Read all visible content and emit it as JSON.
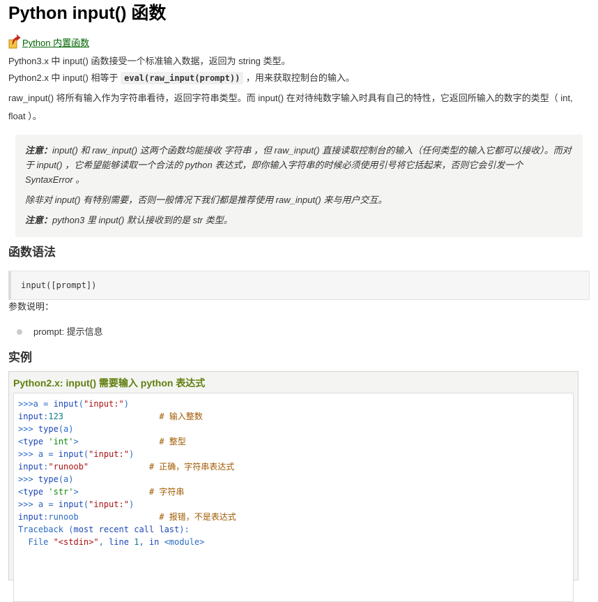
{
  "title": "Python input() 函数",
  "back_link": "Python 内置函数",
  "intro": {
    "p1": "Python3.x 中 input() 函数接受一个标准输入数据，返回为 string 类型。",
    "p2_before": "Python2.x 中 input() 相等于",
    "p2_code": "eval(raw_input(prompt))",
    "p2_after": "，用来获取控制台的输入。",
    "p3": "raw_input() 将所有输入作为字符串看待，返回字符串类型。而 input() 在对待纯数字输入时具有自己的特性，它返回所输入的数字的类型（ int, float ）。"
  },
  "note": {
    "label1": "注意：",
    "text1": "input() 和 raw_input() 这两个函数均能接收 字符串 ，但 raw_input() 直接读取控制台的输入（任何类型的输入它都可以接收）。而对于 input() ，它希望能够读取一个合法的 python 表达式，即你输入字符串的时候必须使用引号将它括起来，否则它会引发一个 SyntaxError 。",
    "text2": "除非对 input() 有特别需要，否则一般情况下我们都是推荐使用 raw_input() 来与用户交互。",
    "label3": "注意：",
    "text3": "python3 里 input() 默认接收到的是 str 类型。"
  },
  "syntax_heading": "函数语法",
  "syntax_code": "input([prompt])",
  "params_label": "参数说明：",
  "params": [
    "prompt: 提示信息"
  ],
  "example_heading": "实例",
  "example_title": "Python2.x: input() 需要输入 python 表达式",
  "code_lines": [
    {
      "a": ">>>a = input(\"input:\")",
      "b": ""
    },
    {
      "a": "input:123",
      "b": "# 输入整数"
    },
    {
      "a": ">>> type(a)",
      "b": ""
    },
    {
      "a": "<type 'int'>",
      "b": "# 整型"
    },
    {
      "a": ">>> a = input(\"input:\")",
      "b": ""
    },
    {
      "a": "input:\"runoob\"",
      "b": "# 正确，字符串表达式"
    },
    {
      "a": ">>> type(a)",
      "b": ""
    },
    {
      "a": "<type 'str'>",
      "b": "# 字符串"
    },
    {
      "a": ">>> a = input(\"input:\")",
      "b": ""
    },
    {
      "a": "input:runoob",
      "b": "# 报错，不是表达式"
    },
    {
      "a": "Traceback (most recent call last):",
      "b": ""
    },
    {
      "a": "  File \"<stdin>\", line 1, in <module>",
      "b": ""
    }
  ],
  "colors": {
    "link": "#006600",
    "example_title": "#617f10",
    "note_bg": "#f4f5f2"
  }
}
